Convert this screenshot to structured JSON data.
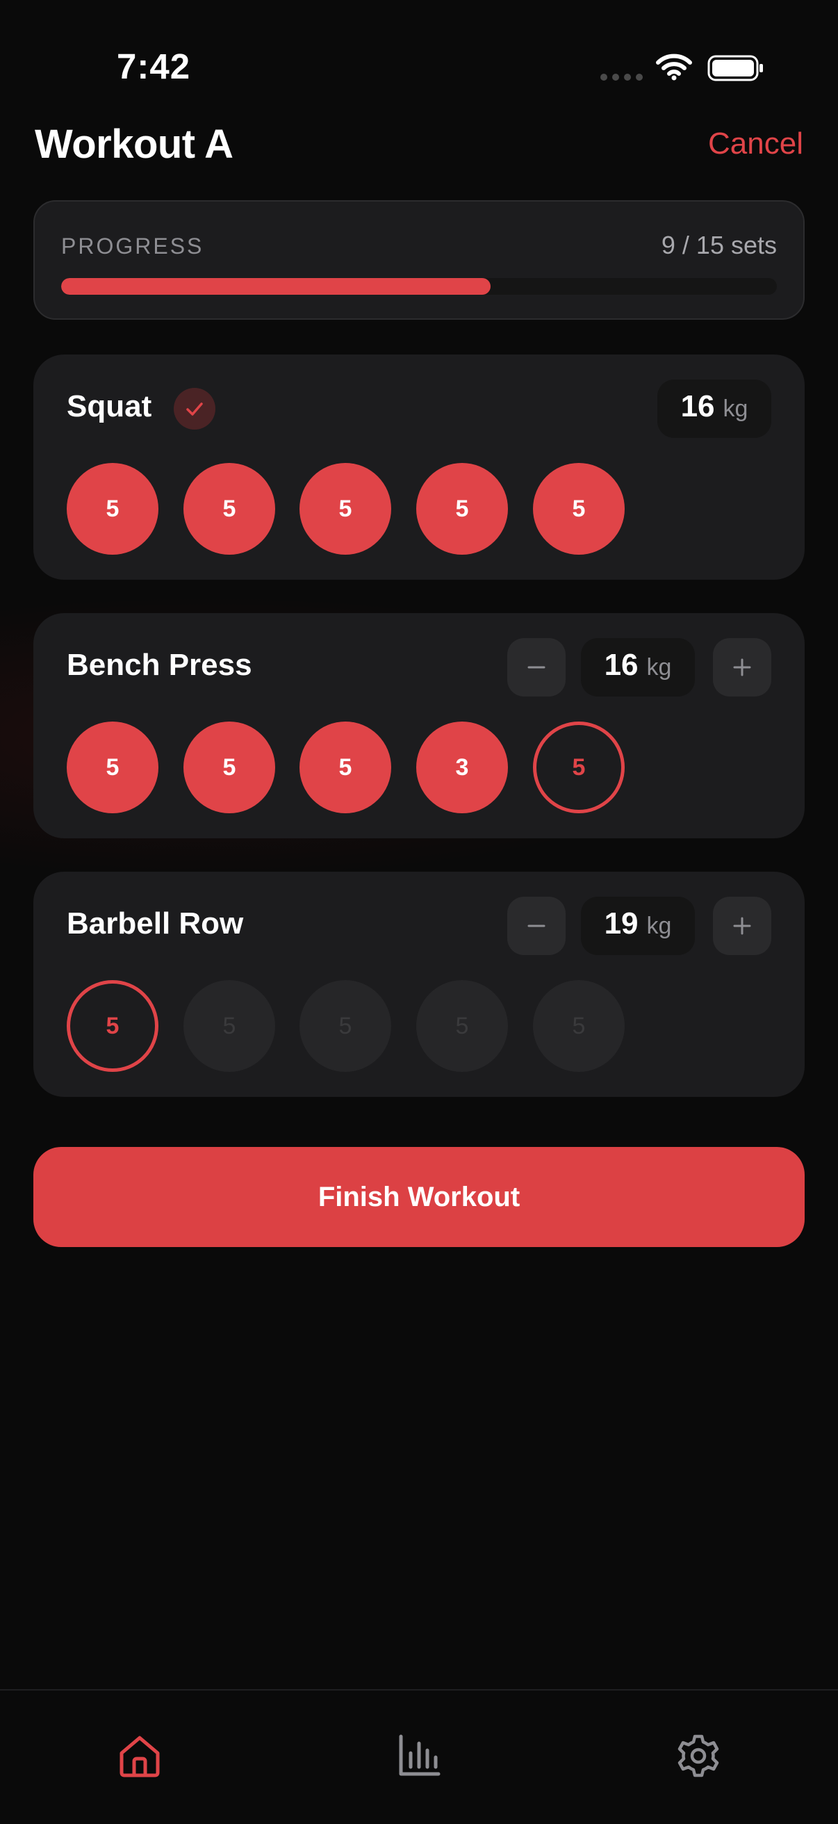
{
  "status_bar": {
    "time": "7:42",
    "icons": [
      "cellular-signal-icon",
      "wifi-icon",
      "battery-icon"
    ]
  },
  "header": {
    "title": "Workout A",
    "cancel_label": "Cancel"
  },
  "progress": {
    "label": "PROGRESS",
    "count_text": "9 / 15 sets",
    "completed": 9,
    "total": 15
  },
  "exercises": [
    {
      "name": "Squat",
      "completed": true,
      "weight": "16",
      "unit": "kg",
      "sets": [
        {
          "reps": "5",
          "state": "done"
        },
        {
          "reps": "5",
          "state": "done"
        },
        {
          "reps": "5",
          "state": "done"
        },
        {
          "reps": "5",
          "state": "done"
        },
        {
          "reps": "5",
          "state": "done"
        }
      ]
    },
    {
      "name": "Bench Press",
      "completed": false,
      "weight": "16",
      "unit": "kg",
      "sets": [
        {
          "reps": "5",
          "state": "done"
        },
        {
          "reps": "5",
          "state": "done"
        },
        {
          "reps": "5",
          "state": "done"
        },
        {
          "reps": "3",
          "state": "done"
        },
        {
          "reps": "5",
          "state": "active"
        }
      ]
    },
    {
      "name": "Barbell Row",
      "completed": false,
      "weight": "19",
      "unit": "kg",
      "sets": [
        {
          "reps": "5",
          "state": "active"
        },
        {
          "reps": "5",
          "state": "pending"
        },
        {
          "reps": "5",
          "state": "pending"
        },
        {
          "reps": "5",
          "state": "pending"
        },
        {
          "reps": "5",
          "state": "pending"
        }
      ]
    }
  ],
  "finish_label": "Finish Workout",
  "tab_bar": {
    "tabs": [
      {
        "icon": "home-icon",
        "active": true
      },
      {
        "icon": "bar-chart-icon",
        "active": false
      },
      {
        "icon": "gear-icon",
        "active": false
      }
    ]
  },
  "colors": {
    "accent": "#e04448",
    "background": "#0a0a0a",
    "card": "#1c1c1e",
    "inactive_icon": "#8e8e93"
  }
}
